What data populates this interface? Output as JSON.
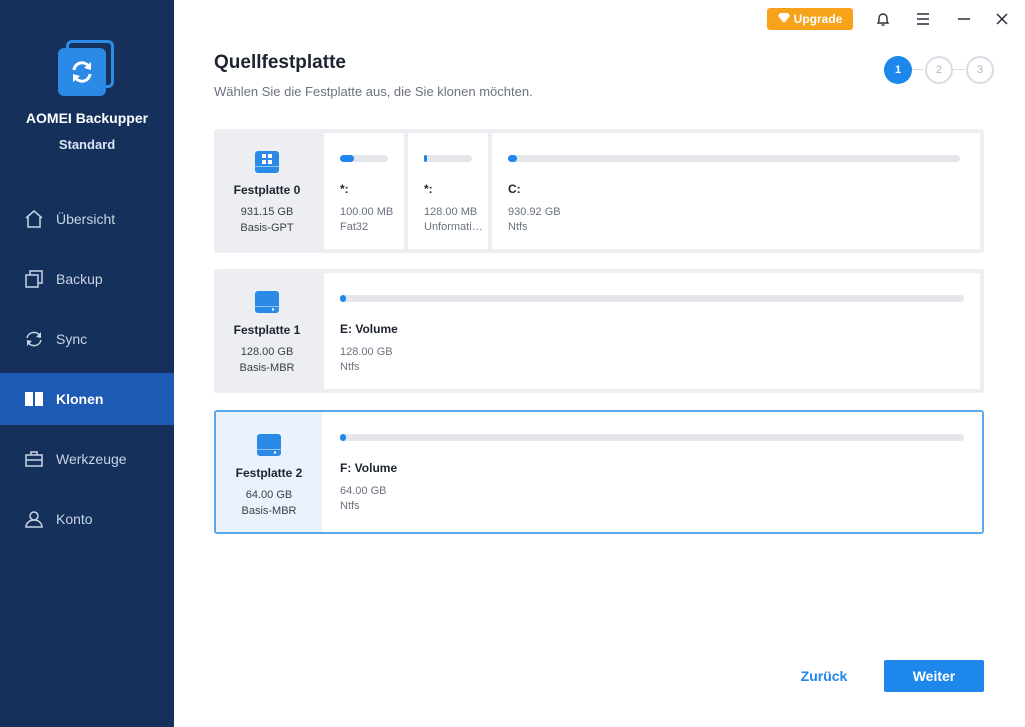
{
  "app": {
    "name": "AOMEI Backupper",
    "edition": "Standard",
    "accent_color": "#1e87eb",
    "sidebar_color": "#15305a"
  },
  "titlebar": {
    "upgrade_label": "Upgrade",
    "icons": [
      "bell-icon",
      "menu-icon",
      "minimize-icon",
      "close-icon"
    ]
  },
  "sidebar": {
    "items": [
      {
        "label": "Übersicht",
        "icon": "home-icon",
        "active": false
      },
      {
        "label": "Backup",
        "icon": "backup-icon",
        "active": false
      },
      {
        "label": "Sync",
        "icon": "sync-icon",
        "active": false
      },
      {
        "label": "Klonen",
        "icon": "clone-icon",
        "active": true
      },
      {
        "label": "Werkzeuge",
        "icon": "toolbox-icon",
        "active": false
      },
      {
        "label": "Konto",
        "icon": "user-icon",
        "active": false
      }
    ]
  },
  "page": {
    "title": "Quellfestplatte",
    "subtitle": "Wählen Sie die Festplatte aus, die Sie klonen möchten.",
    "steps": [
      "1",
      "2",
      "3"
    ],
    "current_step": 1
  },
  "disks": [
    {
      "name": "Festplatte 0",
      "size": "931.15 GB",
      "type": "Basis-GPT",
      "selected": false,
      "partitions": [
        {
          "label": "*:",
          "size": "100.00 MB",
          "fs": "Fat32",
          "used_fraction": 0.3
        },
        {
          "label": "*:",
          "size": "128.00 MB",
          "fs": "Unformatiert",
          "used_fraction": 0.06
        },
        {
          "label": "C:",
          "size": "930.92 GB",
          "fs": "Ntfs",
          "used_fraction": 0.02
        }
      ]
    },
    {
      "name": "Festplatte 1",
      "size": "128.00 GB",
      "type": "Basis-MBR",
      "selected": false,
      "partitions": [
        {
          "label": "E: Volume",
          "size": "128.00 GB",
          "fs": "Ntfs",
          "used_fraction": 0.005
        }
      ]
    },
    {
      "name": "Festplatte 2",
      "size": "64.00 GB",
      "type": "Basis-MBR",
      "selected": true,
      "partitions": [
        {
          "label": "F: Volume",
          "size": "64.00 GB",
          "fs": "Ntfs",
          "used_fraction": 0.005
        }
      ]
    }
  ],
  "footer": {
    "back_label": "Zurück",
    "next_label": "Weiter"
  }
}
